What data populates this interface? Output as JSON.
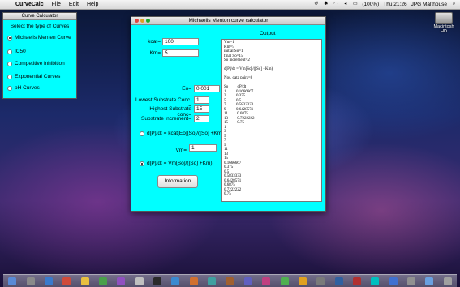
{
  "menubar": {
    "app_name": "CurveCalc",
    "items": [
      "File",
      "Edit",
      "Help"
    ],
    "battery": "(100%)",
    "clock": "Thu 21:26",
    "user": "JPG Malthouse"
  },
  "desktop": {
    "hd_label": "Macintosh HD"
  },
  "curve_window": {
    "title": "Curve Calculator",
    "heading": "Select the type of Curves",
    "options": [
      {
        "label": "Michaelis Menten Curve",
        "selected": true
      },
      {
        "label": "IC50",
        "selected": false
      },
      {
        "label": "Competitive inhibition",
        "selected": false
      },
      {
        "label": "Exponential Curves",
        "selected": false
      },
      {
        "label": "pH Curves",
        "selected": false
      }
    ]
  },
  "main_window": {
    "title": "Michaelis Menton curve calculator",
    "output_label": "Output",
    "kcat_label": "kcat=",
    "kcat_value": "100",
    "km_label": "Km=",
    "km_value": "5",
    "eo_label": "Eo=",
    "eo_value": "0.001",
    "lowest_label": "Lowest Substrate Conc. =",
    "lowest_value": "1",
    "highest_label": "Highest Substrate conc=",
    "highest_value": "15",
    "increment_label": "Substrate increment=",
    "increment_value": "2",
    "eq1_label": "d[P]/dt = kcat[Eo][So]/([So] +Km)",
    "vm_label": "Vm=",
    "vm_value": "1",
    "eq2_label": "d[P]/dt = Vm[So]/([So] +Km)",
    "info_button": "Information",
    "output_text": "Vm=1\nKm=5\ninitial So=1\nfinal So=15\nSo increment=2\n\nd[P]/dt = Vm[So]/([So] +Km)\n\nNos. data pairs=8\n\nSo         dP/dt\n1          0.1666667\n3          0.375\n5          0.5\n7          0.5833333\n9          0.6428571\n11         0.6875\n13         0.7222222\n15         0.75\n1\n3\n5\n7\n9\n11\n13\n15\n0.1666667\n0.375\n0.5\n0.5833333\n0.6428571\n0.6875\n0.7222222\n0.75"
  },
  "colors": {
    "window_bg": "#00ffff"
  }
}
